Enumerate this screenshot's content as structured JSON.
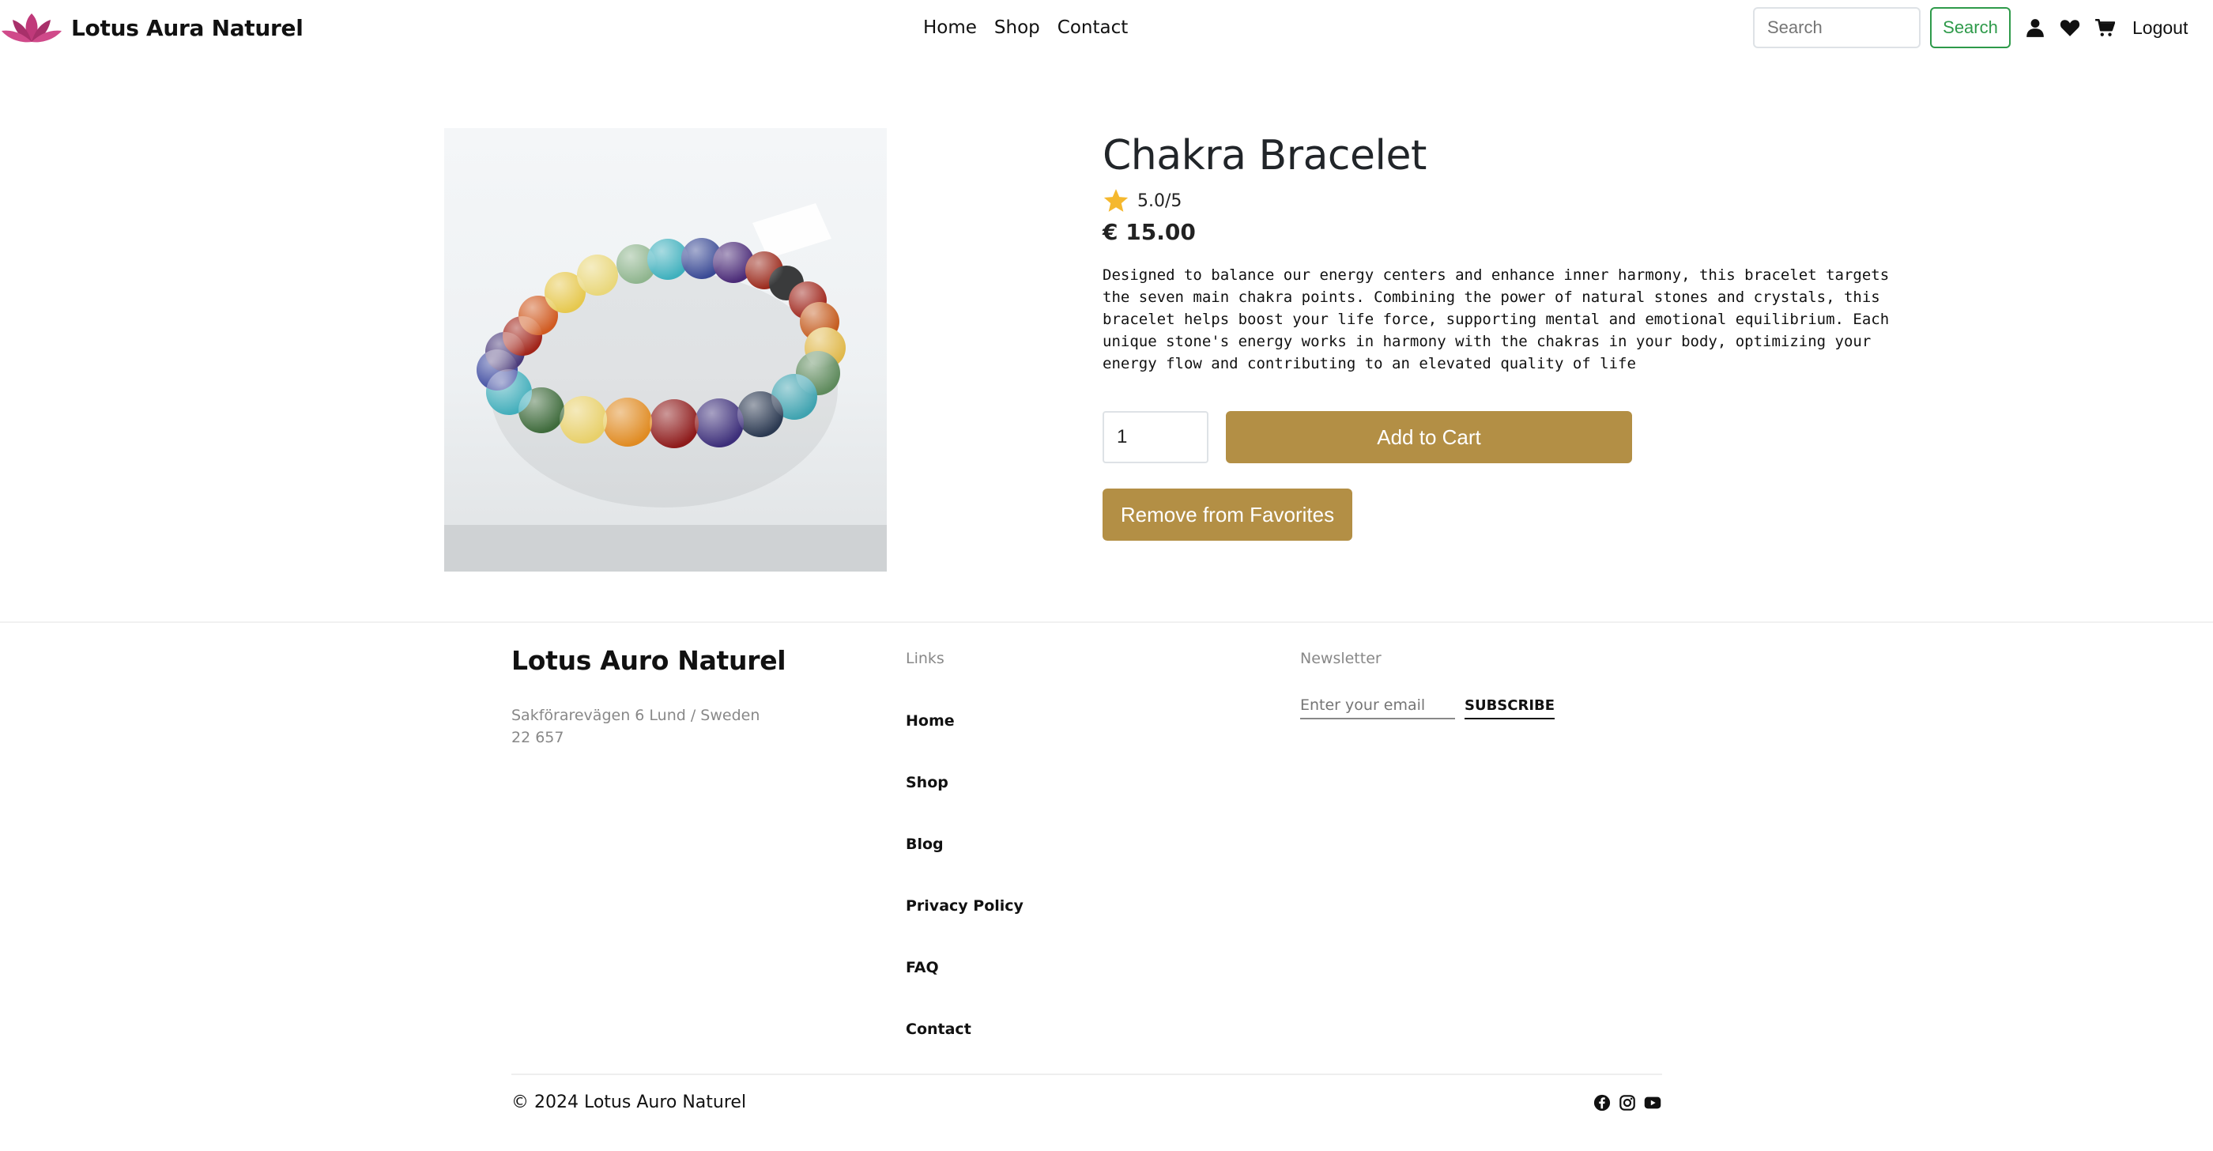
{
  "header": {
    "brand": "Lotus Aura Naturel",
    "nav": [
      "Home",
      "Shop",
      "Contact"
    ],
    "search": {
      "placeholder": "Search",
      "button": "Search"
    },
    "logout": "Logout",
    "icons": [
      "user-icon",
      "heart-icon",
      "cart-icon"
    ]
  },
  "product": {
    "title": "Chakra Bracelet",
    "rating": "5.0/5",
    "price": "€ 15.00",
    "description": "Designed to balance our energy centers and enhance inner harmony, this bracelet targets the seven main chakra points. Combining the power of natural stones and crystals, this bracelet helps boost your life force, supporting mental and emotional equilibrium. Each unique stone's energy works in harmony with the chakras in your body, optimizing your energy flow and contributing to an elevated quality of life",
    "quantity": "1",
    "add_to_cart": "Add to Cart",
    "remove_favorites": "Remove from Favorites"
  },
  "footer": {
    "brand": "Lotus Auro Naturel",
    "address": "Sakförarevägen 6 Lund / Sweden 22 657",
    "links_heading": "Links",
    "links": [
      "Home",
      "Shop",
      "Blog",
      "Privacy Policy",
      "FAQ",
      "Contact"
    ],
    "newsletter_heading": "Newsletter",
    "email_placeholder": "Enter your email",
    "subscribe": "SUBSCRIBE",
    "copyright": "© 2024 Lotus Auro Naturel",
    "socials": [
      "facebook-icon",
      "instagram-icon",
      "youtube-icon"
    ]
  },
  "colors": {
    "accent": "#b38f45",
    "search_green": "#2e9a4a",
    "star": "#f5b82e",
    "lotus": "#c0397a"
  }
}
